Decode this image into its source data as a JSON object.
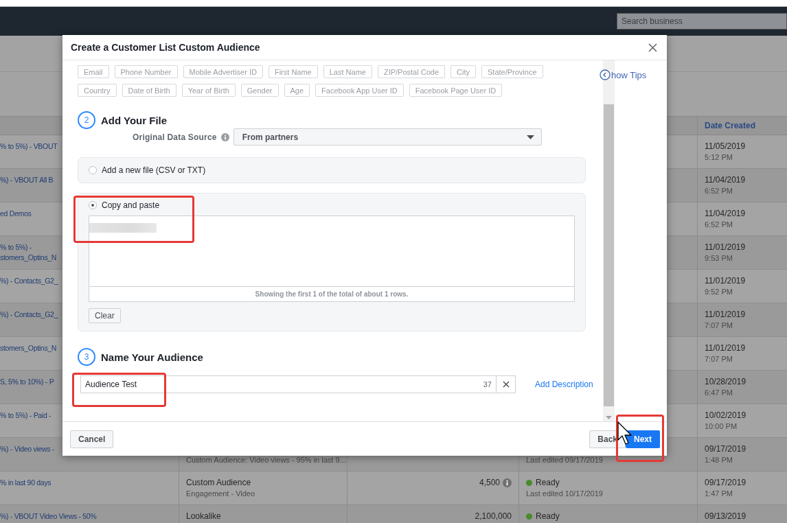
{
  "top_bar": {
    "search": {
      "placeholder": "Search business"
    }
  },
  "table": {
    "date_header": "Date Created",
    "rows": [
      {
        "name": [
          "% to 5%) - VBOUT"
        ],
        "date": "11/05/2019",
        "time": "5:12 PM"
      },
      {
        "name": [
          "%) - VBOUT All B"
        ],
        "date": "11/04/2019",
        "time": "6:52 PM"
      },
      {
        "name": [
          "ed Demos"
        ],
        "date": "11/04/2019",
        "time": "6:52 PM"
      },
      {
        "name": [
          "% to 5%) -",
          "stomers_Optins_N"
        ],
        "date": "11/01/2019",
        "time": "9:53 PM"
      },
      {
        "name": [
          "%) - Contacts_G2_"
        ],
        "date": "11/01/2019",
        "time": "9:52 PM"
      },
      {
        "name": [
          "%) - Contacts_G2_"
        ],
        "date": "11/01/2019",
        "time": "7:07 PM"
      },
      {
        "name": [
          "stomers_Optins_N"
        ],
        "date": "11/01/2019",
        "time": "7:07 PM"
      },
      {
        "name": [
          "S, 5% to 10%) - P"
        ],
        "date": "10/28/2019",
        "time": "6:47 PM"
      },
      {
        "name": [
          "% to 5%) - Paid -"
        ],
        "date": "10/02/2019",
        "time": "10:00 PM"
      },
      {
        "name": [
          "%) - Video views -"
        ],
        "type_detail": "Custom Audience: Video views - 95% in last 9...",
        "status_detail": "Last edited 09/17/2019",
        "date": "09/17/2019",
        "time": "1:48 PM"
      },
      {
        "name": [
          "% in last 90 days"
        ],
        "type": "Custom Audience",
        "type_detail": "Engagement - Video",
        "size": "4,500",
        "size_info": true,
        "status": "Ready",
        "status_detail": "Last edited 10/17/2019",
        "date": "09/17/2019",
        "time": "1:47 PM"
      },
      {
        "name": [
          "%) - VBOUT Video Views - 50%"
        ],
        "type": "Lookalike",
        "size": "2,100,000",
        "size_info": false,
        "status": "Ready",
        "date": "09/13/2019"
      }
    ]
  },
  "dialog": {
    "title": "Create a Customer List Custom Audience",
    "show_tips": "how Tips",
    "identifier_tag_rows": [
      [
        "Email",
        "Phone Number",
        "Mobile Advertiser ID",
        "First Name",
        "Last Name",
        "ZIP/Postal Code",
        "City",
        "State/Province"
      ],
      [
        "Country",
        "Date of Birth",
        "Year of Birth",
        "Gender",
        "Age",
        "Facebook App User ID",
        "Facebook Page User ID"
      ]
    ],
    "add_file": {
      "step": "2",
      "title": "Add Your File",
      "source_label": "Original Data Source",
      "source_value": "From partners",
      "options": [
        {
          "label": "Add a new file (CSV or TXT)",
          "selected": false
        },
        {
          "label": "Copy and paste",
          "selected": true
        }
      ],
      "preview_note": "Showing the first 1 of the total of about 1 rows.",
      "clear": "Clear"
    },
    "name_audience": {
      "step": "3",
      "title": "Name Your Audience",
      "value": "Audience Test",
      "counter": "37",
      "add_description": "Add Description"
    },
    "buttons": {
      "cancel": "Cancel",
      "back": "Back",
      "next": "Next"
    }
  }
}
